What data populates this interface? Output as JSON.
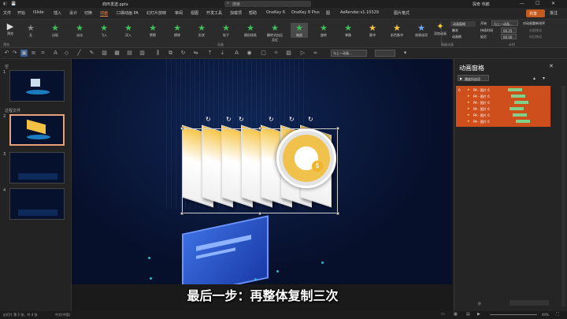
{
  "titlebar": {
    "filename": "商环发送.pptx",
    "search_placeholder": "搜索",
    "user": "探奇 伟鹏"
  },
  "menu": [
    {
      "label": "文件"
    },
    {
      "label": "开始"
    },
    {
      "label": "iSlide"
    },
    {
      "label": "插入"
    },
    {
      "label": "设计"
    },
    {
      "label": "切换"
    },
    {
      "label": "动画"
    },
    {
      "label": "口袋动画 PA"
    },
    {
      "label": "幻灯片放映"
    },
    {
      "label": "审阅"
    },
    {
      "label": "视图"
    },
    {
      "label": "开发工具"
    },
    {
      "label": "加载项"
    },
    {
      "label": "帮助"
    },
    {
      "label": "OneKey 6"
    },
    {
      "label": "OneKey 8 Plus"
    },
    {
      "label": "图"
    },
    {
      "label": "AeRender.v1.10329"
    },
    {
      "label": "图片格式"
    }
  ],
  "share": {
    "share_label": "共享",
    "comment_label": "批注"
  },
  "ribbon": {
    "preview_label": "预览",
    "effects": [
      "无",
      "出现",
      "淡化",
      "飞入",
      "浮入",
      "劈裂",
      "擦除",
      "形状",
      "轮子",
      "随机线条",
      "翻转式由远及近",
      "缩放",
      "旋转",
      "弹跳",
      "脉冲",
      "彩色脉冲"
    ],
    "group_label": "动画",
    "effect_options": "效果选项",
    "add_animation": "添加动画",
    "anim_pane_btn": "动画窗格",
    "trigger": "触发",
    "painter": "动画刷",
    "start_label": "开始",
    "start_value": "与上一动画...",
    "duration_label": "持续时间",
    "duration_value": "00.25",
    "delay_label": "延迟",
    "delay_value": "00.00",
    "reorder_label": "对动画重新排序",
    "move_earlier": "向前移动",
    "move_later": "向后移动",
    "timing_group": "计时",
    "adv_group": "高级动画"
  },
  "toolbar2": {
    "font_value": "与上一动画...",
    "zoom_note": ""
  },
  "slides_panel": {
    "section1": "空",
    "section2": "过程文件",
    "slides": [
      {
        "num": "1"
      },
      {
        "num": "2"
      },
      {
        "num": "3"
      },
      {
        "num": "4"
      }
    ]
  },
  "anim_pane": {
    "title": "动画窗格",
    "play_label": "播放所选项",
    "group_num": "0",
    "items": [
      "PA - 图片 6",
      "PA - 图片 6",
      "PA - 图片 6",
      "PA - 图片 6",
      "PA - 图片 6",
      "PA - 图片 6"
    ],
    "seconds_label": "秒"
  },
  "caption": "最后一步：再整体复制三次",
  "statusbar": {
    "slide_info": "幻灯片 第 2 张，共 4 张",
    "lang": "中文(中国)",
    "zoom": "40%"
  },
  "colors": {
    "accent": "#e07a2f",
    "panel_orange": "#d0501c",
    "slide_bg": "#07102b"
  }
}
